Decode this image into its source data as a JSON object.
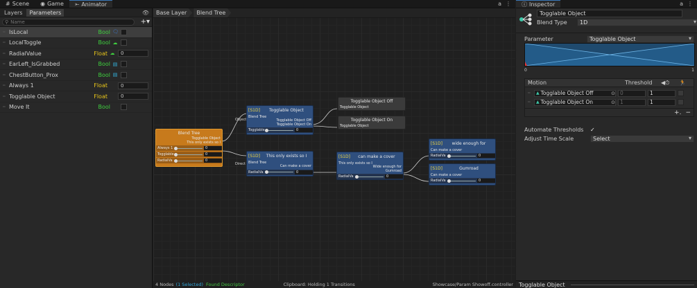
{
  "left_tabs": {
    "scene": "Scene",
    "game": "Game",
    "animator": "Animator"
  },
  "left_tabs_right": {
    "lock": "a",
    "menu": "⋮"
  },
  "panel_tabs": {
    "layers": "Layers",
    "parameters": "Parameters"
  },
  "search": {
    "placeholder": "Name"
  },
  "parameters": [
    {
      "name": "IsLocal",
      "type": "Bool",
      "icon": "chat-icon",
      "color": "#3a7bd5",
      "glyph": "🗨",
      "value": ""
    },
    {
      "name": "LocalToggle",
      "type": "Bool",
      "icon": "cloud-icon",
      "color": "#3fcf3f",
      "glyph": "☁",
      "value": ""
    },
    {
      "name": "RadialValue",
      "type": "Float",
      "icon": "cloud-icon",
      "color": "#3fcf3f",
      "glyph": "☁",
      "value": "0"
    },
    {
      "name": "EarLeft_IsGrabbed",
      "type": "Bool",
      "icon": "document-icon",
      "color": "#35b5e0",
      "glyph": "▤",
      "value": ""
    },
    {
      "name": "ChestButton_Prox",
      "type": "Bool",
      "icon": "document-icon",
      "color": "#35b5e0",
      "glyph": "▤",
      "value": ""
    },
    {
      "name": "Always 1",
      "type": "Float",
      "icon": "",
      "color": "",
      "glyph": "",
      "value": "0"
    },
    {
      "name": "Togglable Object",
      "type": "Float",
      "icon": "",
      "color": "",
      "glyph": "",
      "value": "0"
    },
    {
      "name": "Move It",
      "type": "Bool",
      "icon": "",
      "color": "",
      "glyph": "",
      "value": ""
    }
  ],
  "breadcrumb": {
    "base": "Base Layer",
    "tree": "Blend Tree"
  },
  "status": {
    "nodes": "4 Nodes",
    "selected": "(1 Selected)",
    "descriptor": "Found Descriptor",
    "clipboard": "Clipboard: Holding 1 Transitions",
    "path": "Showcase/Param Showoff.controller"
  },
  "graph": {
    "root": {
      "title": "Blend Tree",
      "sub1": "Togglable Object",
      "sub2": "This only exists so I",
      "slots": [
        {
          "label": "Always 1",
          "value": "0"
        },
        {
          "label": "Togglable",
          "value": "0"
        },
        {
          "label": "RadialVa",
          "value": "0"
        }
      ]
    },
    "n1": {
      "tag": "[S1D]",
      "title": "Togglable Object",
      "line": "Blend Tree",
      "sub1": "Togglable Object Off",
      "sub2": "Togglable Object On",
      "slot_label": "Togglable",
      "value": "0",
      "edge_label": "Object"
    },
    "off": {
      "title": "Togglable Object Off",
      "line": "Togglable Object"
    },
    "on": {
      "title": "Togglable Object On",
      "line": "Togglable Object"
    },
    "n2": {
      "tag": "[S1D]",
      "title": "This only exists so I",
      "line": "Blend Tree",
      "sub1": "Can make a cover",
      "slot_label": "RadialVa",
      "value": "0",
      "edge_label": "Direct"
    },
    "n3": {
      "tag": "[S1D]",
      "title": "can make a cover",
      "line": "This only exists so I",
      "sub1": "Wide enough for",
      "sub2": "Gumroad",
      "slot_label": "RadialVa",
      "value": "0"
    },
    "n4": {
      "tag": "[S1D]",
      "title": "wide enough for",
      "line": "Can make a cover",
      "slot_label": "RadialVa",
      "value": "0"
    },
    "n5": {
      "tag": "[S1D]",
      "title": "Gumroad",
      "line": "Can make a cover",
      "slot_label": "RadialVa",
      "value": "0"
    }
  },
  "inspector": {
    "tab": "Inspector",
    "name": "Togglable Object",
    "blend_type_label": "Blend Type",
    "blend_type": "1D",
    "parameter_label": "Parameter",
    "parameter": "Togglable Object",
    "axis_min": "0",
    "axis_max": "1",
    "motion_header": "Motion",
    "threshold_header": "Threshold",
    "motions": [
      {
        "name": "Togglable Object Off",
        "threshold": "0",
        "speed": "1"
      },
      {
        "name": "Togglable Object On",
        "threshold": "1",
        "speed": "1"
      }
    ],
    "automate_label": "Automate Thresholds",
    "automate_checked": "✓",
    "adjust_label": "Adjust Time Scale",
    "adjust_value": "Select",
    "preview_name": "Togglable Object"
  }
}
